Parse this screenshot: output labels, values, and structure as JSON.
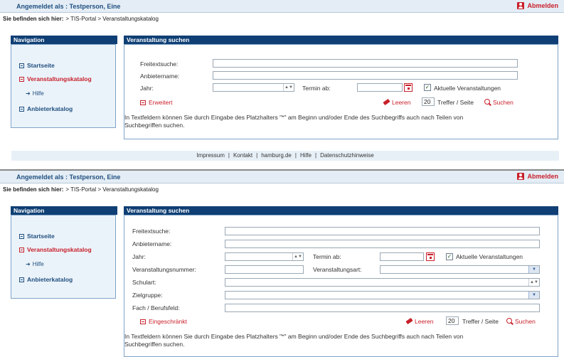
{
  "top": {
    "login_label": "Angemeldet als : Testperson, Eine",
    "logout_label": "Abmelden"
  },
  "breadcrumb": {
    "label": "Sie befinden sich hier:",
    "path": "> TIS-Portal > Veranstaltungskatalog"
  },
  "nav": {
    "header": "Navigation",
    "items": [
      {
        "label": "Startseite"
      },
      {
        "label": "Veranstaltungskatalog"
      },
      {
        "label": "Hilfe"
      },
      {
        "label": "Anbieterkatalog"
      }
    ]
  },
  "search": {
    "header": "Veranstaltung suchen",
    "fields": {
      "freitext": "Freitextsuche:",
      "anbieter": "Anbietername:",
      "jahr": "Jahr:",
      "termin": "Termin ab:",
      "aktuelle": "Aktuelle Veranstaltungen",
      "vnummer": "Veranstaltungsnummer:",
      "vart": "Veranstaltungsart:",
      "schulart": "Schulart:",
      "zielgruppe": "Zielgruppe:",
      "fach": "Fach / Berufsfeld:"
    },
    "erweitert": "Erweitert",
    "eingeschraenkt": "Eingeschränkt",
    "leeren": "Leeren",
    "per_page_value": "20",
    "per_page_label": "Treffer / Seite",
    "suchen": "Suchen",
    "hint_line1": "In Textfeldern können Sie durch Eingabe des Platzhalters \"*\" am Beginn und/oder Ende des Suchbegriffs auch nach Teilen von",
    "hint_line2": "Suchbegriffen suchen."
  },
  "footer": {
    "links": [
      "Impressum",
      "Kontakt",
      "hamburg.de",
      "Hilfe",
      "Datenschutzhinweise"
    ],
    "separator": "|"
  },
  "colors": {
    "navy": "#0f3f74",
    "red": "#c8202b",
    "nav_bg": "#ebf3fa",
    "topbar_bg": "#e4edf5"
  }
}
